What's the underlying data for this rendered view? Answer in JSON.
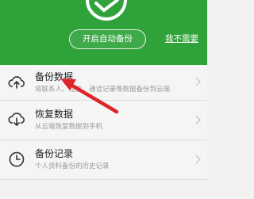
{
  "header": {
    "auto_backup_button": "开启自动备份",
    "skip_link": "我不需要"
  },
  "menu": [
    {
      "title": "备份数据",
      "description": "将联系人、短信、通话记录等数据备份到云端",
      "icon": "cloud-upload-icon"
    },
    {
      "title": "恢复数据",
      "description": "从云端恢复数据到手机",
      "icon": "cloud-download-icon"
    },
    {
      "title": "备份记录",
      "description": "个人资料备份的历史记录",
      "icon": "clock-icon"
    }
  ],
  "colors": {
    "header_green": "#2fa33a",
    "annotation_red": "#e0252a",
    "list_background": "#f5f5f5"
  }
}
